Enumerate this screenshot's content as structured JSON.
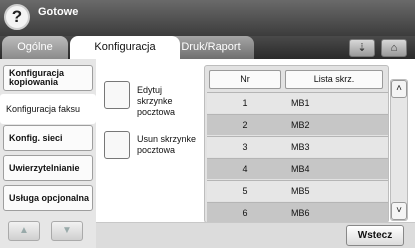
{
  "header": {
    "help_label": "?",
    "title": "Gotowe"
  },
  "tabs": [
    {
      "label": "Ogólne"
    },
    {
      "label": "Konfiguracja"
    },
    {
      "label": "Druk/Raport"
    }
  ],
  "header_buttons": {
    "inbox_icon": "⇣",
    "home_icon": "⌂"
  },
  "sidebar": {
    "items": [
      {
        "label": "Konfiguracja kopiowania"
      },
      {
        "label": "Konfiguracja faksu"
      },
      {
        "label": "Konfig. sieci"
      },
      {
        "label": "Uwierzytelnianie"
      },
      {
        "label": "Usługa opcjonalna"
      }
    ],
    "up_arrow": "▲",
    "down_arrow": "▼"
  },
  "actions": {
    "edit_label": "Edytuj skrzynke pocztowa",
    "delete_label": "Usun skrzynke pocztowa"
  },
  "table": {
    "columns": [
      "Nr",
      "Lista skrz."
    ],
    "rows": [
      {
        "nr": "1",
        "name": "MB1"
      },
      {
        "nr": "2",
        "name": "MB2"
      },
      {
        "nr": "3",
        "name": "MB3"
      },
      {
        "nr": "4",
        "name": "MB4"
      },
      {
        "nr": "5",
        "name": "MB5"
      },
      {
        "nr": "6",
        "name": "MB6"
      }
    ]
  },
  "scrollbar": {
    "up": "˄",
    "down": "˅"
  },
  "footer": {
    "back_label": "Wstecz"
  }
}
